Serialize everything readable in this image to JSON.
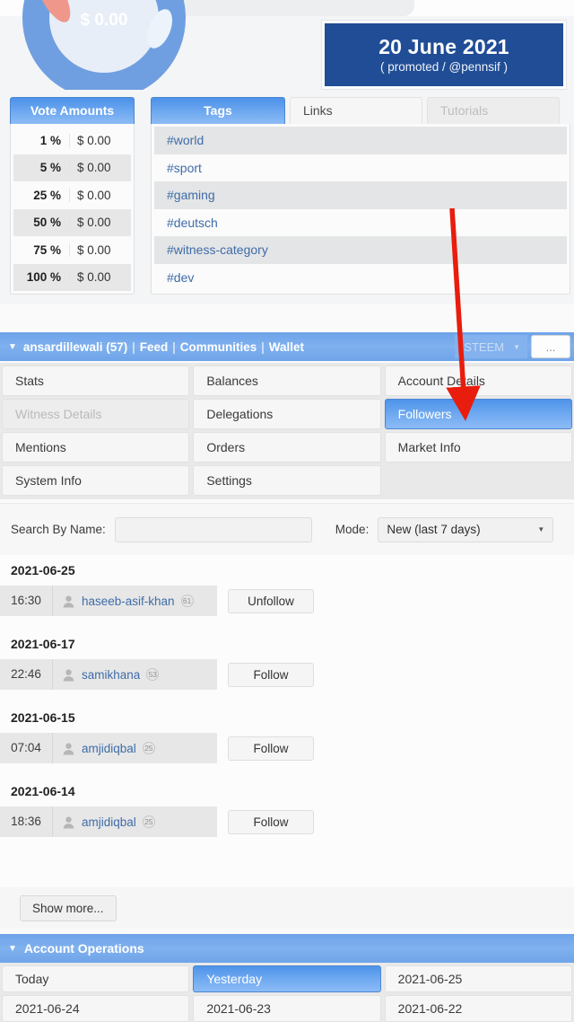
{
  "promo": {
    "date": "20 June 2021",
    "subtitle": "( promoted / @pennsif )"
  },
  "donut": {
    "center_label": "$ 0.00"
  },
  "vote_amounts": {
    "title": "Vote Amounts",
    "rows": [
      {
        "percent": "1 %",
        "amount": "$ 0.00"
      },
      {
        "percent": "5 %",
        "amount": "$ 0.00"
      },
      {
        "percent": "25 %",
        "amount": "$ 0.00"
      },
      {
        "percent": "50 %",
        "amount": "$ 0.00"
      },
      {
        "percent": "75 %",
        "amount": "$ 0.00"
      },
      {
        "percent": "100 %",
        "amount": "$ 0.00"
      }
    ]
  },
  "tags_panel": {
    "tabs": [
      {
        "label": "Tags",
        "state": "active"
      },
      {
        "label": "Links",
        "state": "normal"
      },
      {
        "label": "Tutorials",
        "state": "disabled"
      }
    ],
    "tags": [
      "#world",
      "#sport",
      "#gaming",
      "#deutsch",
      "#witness-category",
      "#dev"
    ]
  },
  "account_bar": {
    "caret": "caret-down-icon",
    "username": "ansardillewali (57)",
    "sep": "|",
    "links": [
      "Feed",
      "Communities",
      "Wallet"
    ],
    "currency": "STEEM",
    "more_label": "..."
  },
  "tab_grid": [
    {
      "label": "Stats",
      "state": "normal"
    },
    {
      "label": "Balances",
      "state": "normal"
    },
    {
      "label": "Account Details",
      "state": "normal"
    },
    {
      "label": "Witness Details",
      "state": "disabled"
    },
    {
      "label": "Delegations",
      "state": "normal"
    },
    {
      "label": "Followers",
      "state": "active"
    },
    {
      "label": "Mentions",
      "state": "normal"
    },
    {
      "label": "Orders",
      "state": "normal"
    },
    {
      "label": "Market Info",
      "state": "normal"
    },
    {
      "label": "System Info",
      "state": "normal"
    },
    {
      "label": "Settings",
      "state": "normal"
    },
    {
      "label": "",
      "state": "empty"
    }
  ],
  "search": {
    "label": "Search By Name:",
    "value": "",
    "placeholder": "",
    "mode_label": "Mode:",
    "mode_value": "New (last 7 days)"
  },
  "followers": {
    "groups": [
      {
        "date": "2021-06-25",
        "rows": [
          {
            "time": "16:30",
            "name": "haseeb-asif-khan",
            "rep": "61",
            "action": "Unfollow"
          }
        ]
      },
      {
        "date": "2021-06-17",
        "rows": [
          {
            "time": "22:46",
            "name": "samikhana",
            "rep": "53",
            "action": "Follow"
          }
        ]
      },
      {
        "date": "2021-06-15",
        "rows": [
          {
            "time": "07:04",
            "name": "amjidiqbal",
            "rep": "25",
            "action": "Follow"
          }
        ]
      },
      {
        "date": "2021-06-14",
        "rows": [
          {
            "time": "18:36",
            "name": "amjidiqbal",
            "rep": "25",
            "action": "Follow"
          }
        ]
      }
    ],
    "show_more": "Show more..."
  },
  "account_operations": {
    "title": "Account Operations",
    "caret": "caret-down-icon",
    "cells": [
      {
        "label": "Today",
        "state": "normal"
      },
      {
        "label": "Yesterday",
        "state": "active"
      },
      {
        "label": "2021-06-25",
        "state": "normal"
      },
      {
        "label": "2021-06-24",
        "state": "normal"
      },
      {
        "label": "2021-06-23",
        "state": "normal"
      },
      {
        "label": "2021-06-22",
        "state": "normal"
      }
    ]
  },
  "colors": {
    "accent_blue": "#6fa4e9",
    "tab_active_blue": "#4e93e9",
    "promo_navy": "#204d96",
    "link_blue": "#3f6ca8",
    "annotation_red": "#e81d0d"
  }
}
